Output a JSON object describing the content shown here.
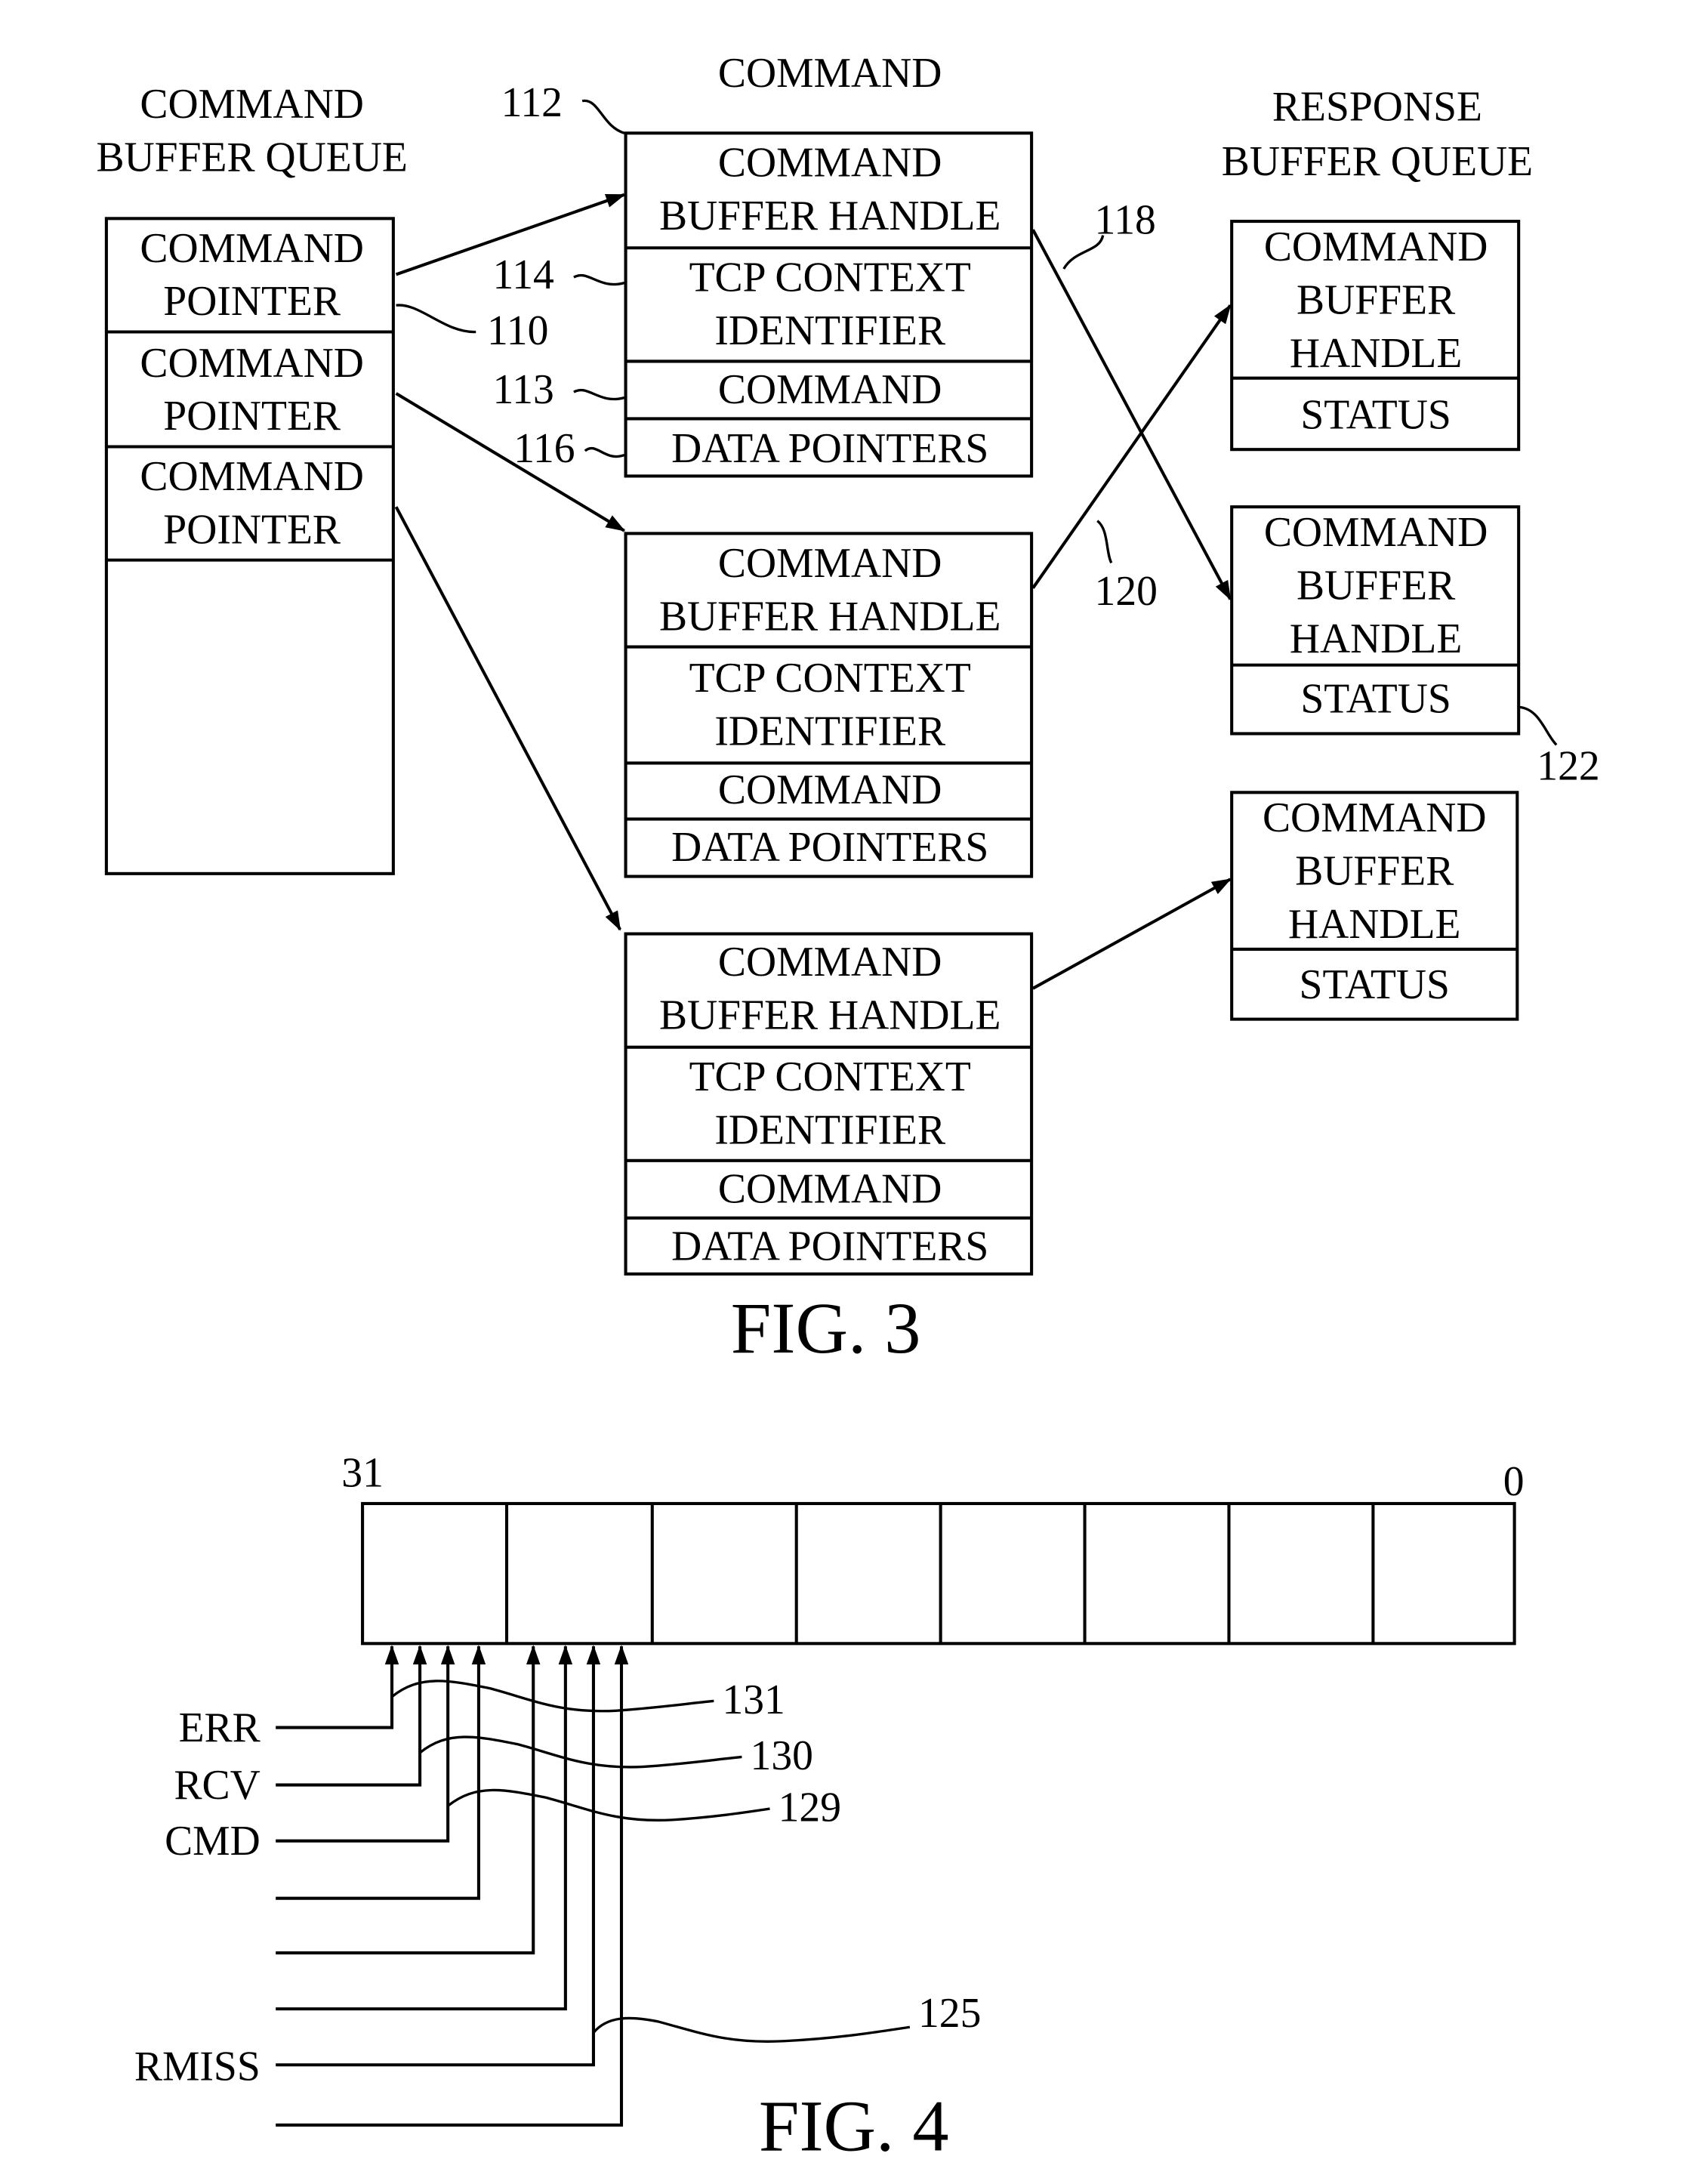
{
  "fig3": {
    "caption": "FIG. 3",
    "command_buffer_queue": {
      "title_line1": "COMMAND",
      "title_line2": "BUFFER QUEUE",
      "entries": [
        {
          "line1": "COMMAND",
          "line2": "POINTER"
        },
        {
          "line1": "COMMAND",
          "line2": "POINTER"
        },
        {
          "line1": "COMMAND",
          "line2": "POINTER"
        }
      ]
    },
    "command": {
      "title": "COMMAND",
      "blocks": [
        {
          "handle_line1": "COMMAND",
          "handle_line2": "BUFFER HANDLE",
          "tcp_line1": "TCP CONTEXT",
          "tcp_line2": "IDENTIFIER",
          "command": "COMMAND",
          "data_pointers": "DATA POINTERS"
        },
        {
          "handle_line1": "COMMAND",
          "handle_line2": "BUFFER HANDLE",
          "tcp_line1": "TCP CONTEXT",
          "tcp_line2": "IDENTIFIER",
          "command": "COMMAND",
          "data_pointers": "DATA POINTERS"
        },
        {
          "handle_line1": "COMMAND",
          "handle_line2": "BUFFER HANDLE",
          "tcp_line1": "TCP CONTEXT",
          "tcp_line2": "IDENTIFIER",
          "command": "COMMAND",
          "data_pointers": "DATA POINTERS"
        }
      ]
    },
    "response_buffer_queue": {
      "title_line1": "RESPONSE",
      "title_line2": "BUFFER QUEUE",
      "entries": [
        {
          "line1": "COMMAND",
          "line2": "BUFFER",
          "line3": "HANDLE",
          "status": "STATUS"
        },
        {
          "line1": "COMMAND",
          "line2": "BUFFER",
          "line3": "HANDLE",
          "status": "STATUS"
        },
        {
          "line1": "COMMAND",
          "line2": "BUFFER",
          "line3": "HANDLE",
          "status": "STATUS"
        }
      ]
    },
    "refs": {
      "r110": "110",
      "r112": "112",
      "r113": "113",
      "r114": "114",
      "r116": "116",
      "r118": "118",
      "r120": "120",
      "r122": "122"
    }
  },
  "fig4": {
    "caption": "FIG. 4",
    "bit_high": "31",
    "bit_low": "0",
    "field_count": 8,
    "signals": [
      "ERR",
      "RCV",
      "CMD",
      "",
      "",
      "",
      "RMISS",
      ""
    ],
    "refs": {
      "r131": "131",
      "r130": "130",
      "r129": "129",
      "r125": "125"
    }
  }
}
